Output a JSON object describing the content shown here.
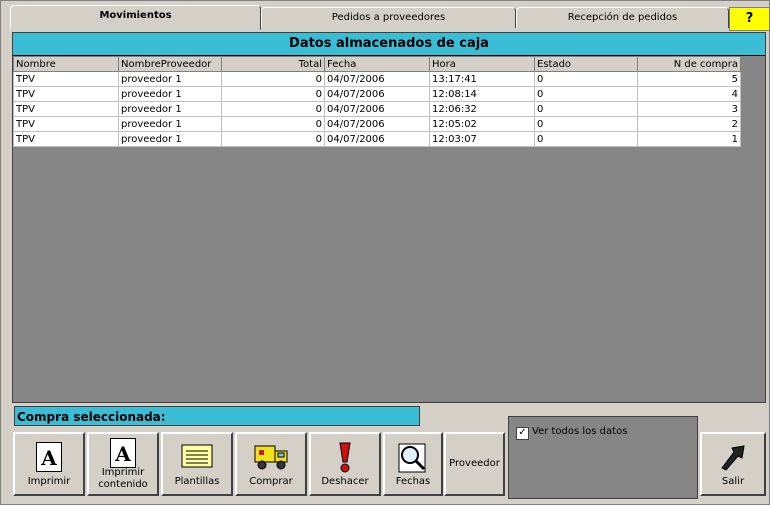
{
  "tabs": [
    {
      "label": "Movimientos"
    },
    {
      "label": "Pedidos a proveedores"
    },
    {
      "label": "Recepción de pedidos"
    }
  ],
  "help_label": "?",
  "grid": {
    "title": "Datos almacenados de caja",
    "columns": [
      "Nombre",
      "NombreProveedor",
      "Total",
      "Fecha",
      "Hora",
      "Estado",
      "N de compra"
    ],
    "rows": [
      [
        "TPV",
        "proveedor 1",
        "0",
        "04/07/2006",
        "13:17:41",
        "0",
        "5"
      ],
      [
        "TPV",
        "proveedor 1",
        "0",
        "04/07/2006",
        "12:08:14",
        "0",
        "4"
      ],
      [
        "TPV",
        "proveedor 1",
        "0",
        "04/07/2006",
        "12:06:32",
        "0",
        "3"
      ],
      [
        "TPV",
        "proveedor 1",
        "0",
        "04/07/2006",
        "12:05:02",
        "0",
        "2"
      ],
      [
        "TPV",
        "proveedor 1",
        "0",
        "04/07/2006",
        "12:03:07",
        "0",
        "1"
      ]
    ]
  },
  "selected_label": "Compra seleccionada:",
  "buttons": {
    "imprimir": "Imprimir",
    "imprimir_contenido": "Imprimir contenido",
    "plantillas": "Plantillas",
    "comprar": "Comprar",
    "deshacer": "Deshacer",
    "fechas": "Fechas",
    "proveedor": "Proveedor",
    "salir": "Salir"
  },
  "ver_todos": {
    "label": "Ver todos los datos",
    "checked": true
  },
  "colors": {
    "accent": "#3cbdd6",
    "panel": "#868686",
    "help": "#ffff00"
  }
}
